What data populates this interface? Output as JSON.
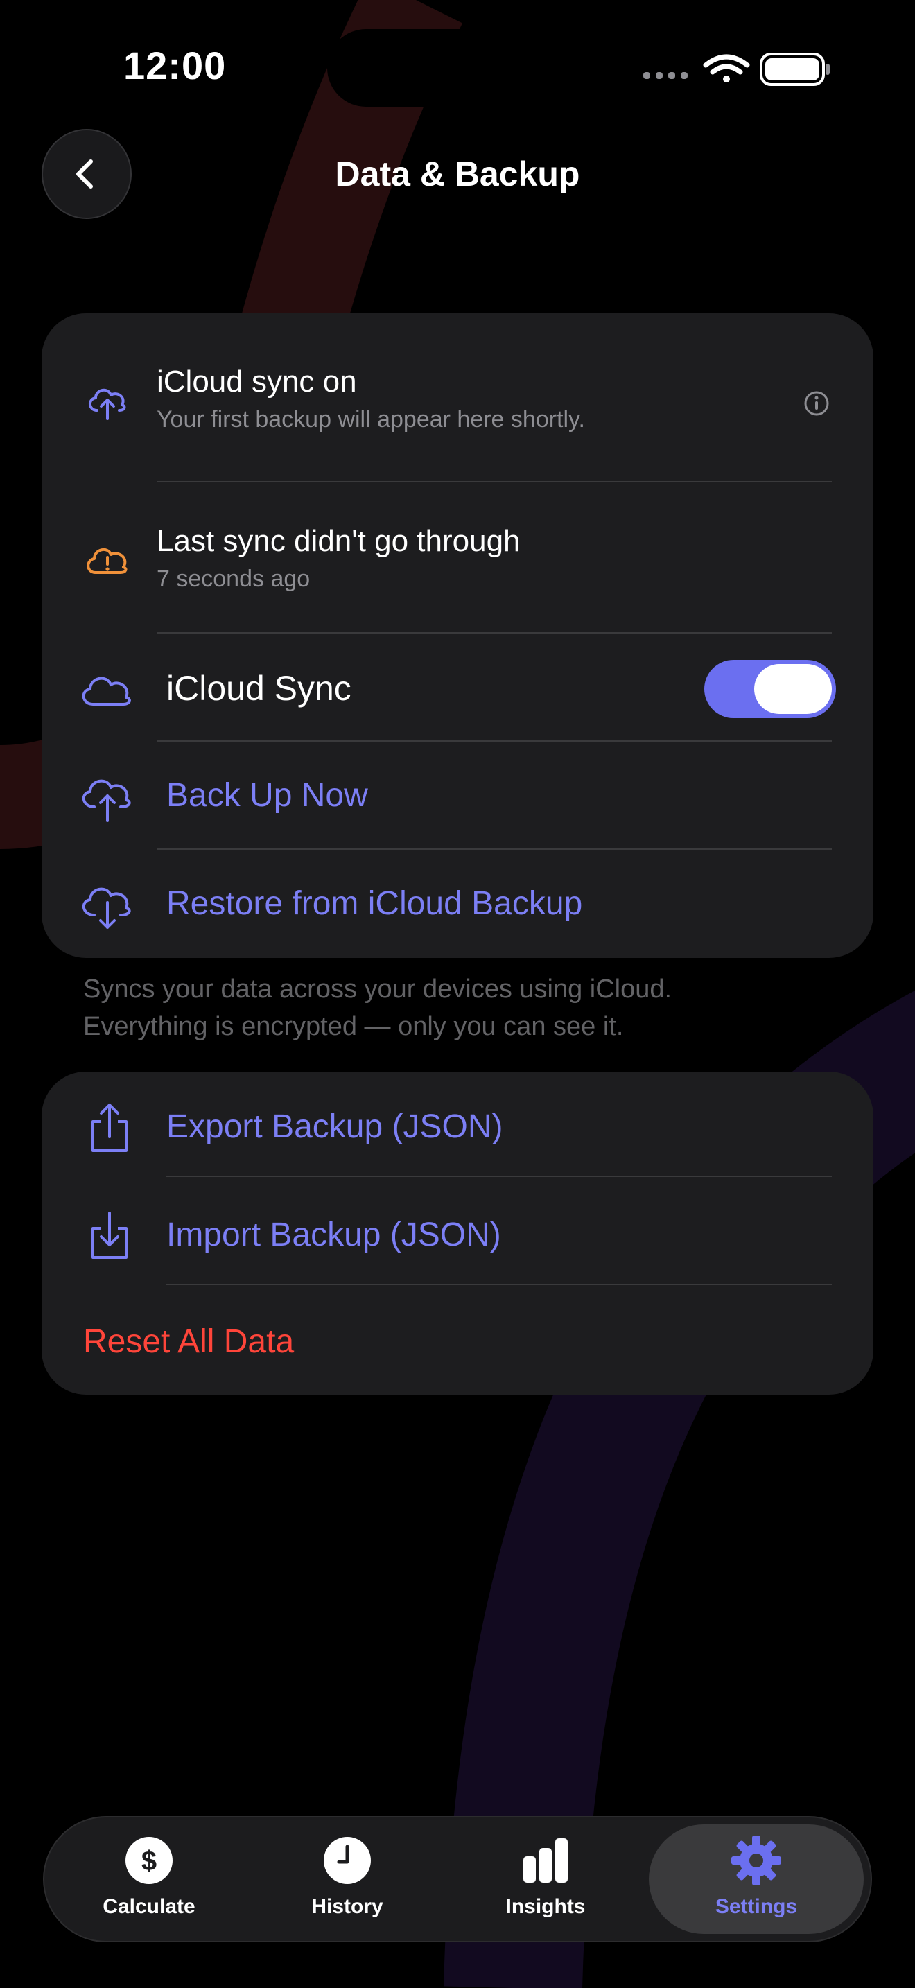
{
  "status_bar": {
    "time": "12:00"
  },
  "nav": {
    "title": "Data & Backup"
  },
  "sync_card": {
    "status_row": {
      "title": "iCloud sync on",
      "subtitle": "Your first backup will appear here shortly."
    },
    "error_row": {
      "title": "Last sync didn't go through",
      "subtitle": "7 seconds ago"
    },
    "toggle_row": {
      "label": "iCloud Sync",
      "enabled": true
    },
    "backup_now": "Back Up Now",
    "restore": "Restore from iCloud Backup"
  },
  "footer_note": {
    "line1": "Syncs your data across your devices using iCloud.",
    "line2": "Everything is encrypted — only you can see it."
  },
  "data_card": {
    "export": "Export Backup (JSON)",
    "import": "Import Backup (JSON)",
    "reset": "Reset All Data"
  },
  "tab_bar": {
    "tabs": [
      {
        "label": "Calculate",
        "icon": "dollar-circle-icon"
      },
      {
        "label": "History",
        "icon": "clock-icon"
      },
      {
        "label": "Insights",
        "icon": "bar-chart-icon"
      },
      {
        "label": "Settings",
        "icon": "gear-icon",
        "selected": true
      }
    ]
  },
  "colors": {
    "accent": "#7c7ff5",
    "warning": "#f0913a",
    "destructive": "#ff453a",
    "card": "#1d1d1f"
  }
}
